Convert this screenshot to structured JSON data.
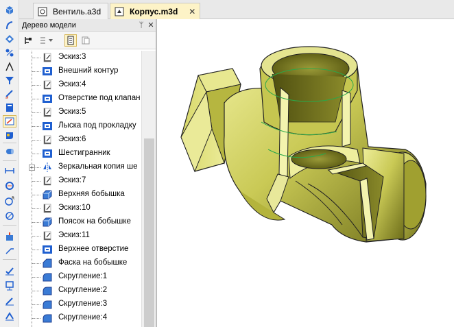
{
  "tabs": [
    {
      "label": "Вентиль.a3d",
      "icon": "assembly-doc-icon",
      "active": false
    },
    {
      "label": "Корпус.m3d",
      "icon": "part-doc-icon",
      "active": true,
      "close": "✕"
    }
  ],
  "tree_panel": {
    "title": "Дерево модели",
    "pin": "ᛘ",
    "close": "✕"
  },
  "tree_items": [
    {
      "label": "Эскиз:3",
      "icon": "sketch-icon"
    },
    {
      "label": "Внешний контур",
      "icon": "cut-icon"
    },
    {
      "label": "Эскиз:4",
      "icon": "sketch-icon"
    },
    {
      "label": "Отверстие под клапан",
      "icon": "cut-icon"
    },
    {
      "label": "Эскиз:5",
      "icon": "sketch-icon"
    },
    {
      "label": "Лыска под прокладку",
      "icon": "cut-icon"
    },
    {
      "label": "Эскиз:6",
      "icon": "sketch-icon"
    },
    {
      "label": "Шестигранник",
      "icon": "cut-icon"
    },
    {
      "label": "Зеркальная копия ше",
      "icon": "mirror-icon",
      "expandable": true
    },
    {
      "label": "Эскиз:7",
      "icon": "sketch-icon"
    },
    {
      "label": "Верхняя бобышка",
      "icon": "extrude-icon"
    },
    {
      "label": "Эскиз:10",
      "icon": "sketch-icon"
    },
    {
      "label": "Поясок на бобышке",
      "icon": "extrude-icon"
    },
    {
      "label": "Эскиз:11",
      "icon": "sketch-icon"
    },
    {
      "label": "Верхнее отверстие",
      "icon": "cut-icon"
    },
    {
      "label": "Фаска  на бобышке",
      "icon": "chamfer-icon"
    },
    {
      "label": "Скругление:1",
      "icon": "fillet-icon"
    },
    {
      "label": "Скругление:2",
      "icon": "fillet-icon"
    },
    {
      "label": "Скругление:3",
      "icon": "fillet-icon"
    },
    {
      "label": "Скругление:4",
      "icon": "fillet-icon"
    }
  ],
  "colors": {
    "model_yellow": "#c8c850",
    "model_dark": "#5f5f14",
    "tab_active_bg": "#fdf3c7",
    "icon_blue": "#1f5fd0"
  }
}
